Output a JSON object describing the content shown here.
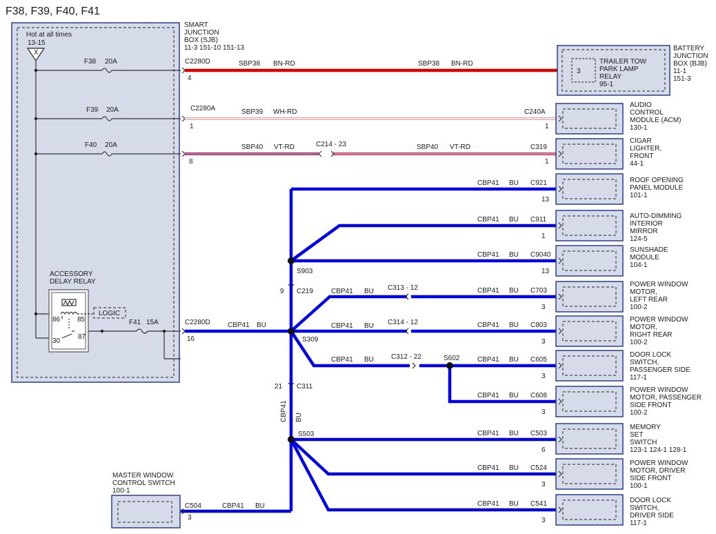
{
  "title": "F38, F39, F40, F41",
  "sjb": {
    "name_lines": [
      "SMART",
      "JUNCTION",
      "BOX (SJB)",
      "11-3  151-10   151-13"
    ],
    "hot": "Hot at all times",
    "hot_ref": "13-15",
    "x": "X"
  },
  "relay": {
    "name_lines": [
      "ACCESSORY",
      "DELAY RELAY"
    ],
    "logic": "LOGIC",
    "pins": [
      "86",
      "85",
      "30",
      "87"
    ]
  },
  "fuses": [
    {
      "name": "F38",
      "rating": "20A"
    },
    {
      "name": "F39",
      "rating": "20A"
    },
    {
      "name": "F40",
      "rating": "20A"
    },
    {
      "name": "F41",
      "rating": "15A"
    }
  ],
  "wires": {
    "sbp38": {
      "circuit": "SBP38",
      "color": "BN-RD"
    },
    "sbp39": {
      "circuit": "SBP39",
      "color": "WH-RD"
    },
    "sbp40": {
      "circuit": "SBP40",
      "color": "VT-RD"
    },
    "cbp41": {
      "circuit": "CBP41",
      "color": "BU"
    }
  },
  "connectors": {
    "c2280d_top": {
      "name": "C2280D",
      "pin": "4"
    },
    "c2280a": {
      "name": "C2280A",
      "pin": "1"
    },
    "c2280_8": {
      "pin": "8"
    },
    "c2280d_low": {
      "name": "C2280D",
      "pin": "16"
    },
    "c240a": {
      "name": "C240A",
      "pin": "1"
    },
    "c214": {
      "name": "C214 - 23"
    },
    "c319": {
      "name": "C319",
      "pin": "1"
    },
    "c219": {
      "name": "C219",
      "pin": "9"
    },
    "c311": {
      "name": "C311",
      "pin": "21"
    },
    "c313": {
      "name": "C313 - 12"
    },
    "c314": {
      "name": "C314 - 12"
    },
    "c312": {
      "name": "C312 - 22"
    },
    "c504": {
      "name": "C504",
      "pin": "3"
    }
  },
  "splices": [
    "S903",
    "S309",
    "S602",
    "S503"
  ],
  "bjb": {
    "name_lines": [
      "BATTERY",
      "JUNCTION",
      "BOX (BJB)",
      "11-1",
      "151-3"
    ],
    "relay_lines": [
      "TRAILER TOW",
      "PARK LAMP",
      "RELAY",
      "95-1"
    ],
    "pin": "3"
  },
  "modules": [
    {
      "conn": "C240A",
      "pin": "1",
      "lines": [
        "AUDIO",
        "CONTROL",
        "MODULE (ACM)",
        "130-1"
      ]
    },
    {
      "conn": "C319",
      "pin": "1",
      "lines": [
        "CIGAR",
        "LIGHTER,",
        "FRONT",
        "44-1"
      ]
    },
    {
      "conn": "C921",
      "pin": "13",
      "lines": [
        "ROOF OPENING",
        "PANEL MODULE",
        "101-1"
      ]
    },
    {
      "conn": "C911",
      "pin": "1",
      "lines": [
        "AUTO-DIMMING",
        "INTERIOR",
        "MIRROR",
        "124-5"
      ]
    },
    {
      "conn": "C9040",
      "pin": "13",
      "lines": [
        "SUNSHADE",
        "MODULE",
        "104-1"
      ]
    },
    {
      "conn": "C703",
      "pin": "3",
      "lines": [
        "POWER WINDOW",
        "MOTOR,",
        "LEFT REAR",
        "100-2"
      ]
    },
    {
      "conn": "C803",
      "pin": "3",
      "lines": [
        "POWER WINDOW",
        "MOTOR,",
        "RIGHT REAR",
        "100-2"
      ]
    },
    {
      "conn": "C605",
      "pin": "3",
      "lines": [
        "DOOR LOCK",
        "SWITCH,",
        "PASSENGER SIDE",
        "117-1"
      ]
    },
    {
      "conn": "C608",
      "pin": "3",
      "lines": [
        "POWER WINDOW",
        "MOTOR, PASSENGER",
        "SIDE FRONT",
        "100-2"
      ]
    },
    {
      "conn": "C503",
      "pin": "6",
      "lines": [
        "MEMORY",
        "SET",
        "SWITCH",
        "123-1  124-1   128-1"
      ]
    },
    {
      "conn": "C524",
      "pin": "3",
      "lines": [
        "POWER WINDOW",
        "MOTOR, DRIVER",
        "SIDE FRONT",
        "100-1"
      ]
    },
    {
      "conn": "C541",
      "pin": "3",
      "lines": [
        "DOOR LOCK",
        "SWITCH,",
        "DRIVER SIDE",
        "117-1"
      ]
    }
  ],
  "master": {
    "lines": [
      "MASTER WINDOW",
      "CONTROL SWITCH",
      "100-1"
    ]
  }
}
